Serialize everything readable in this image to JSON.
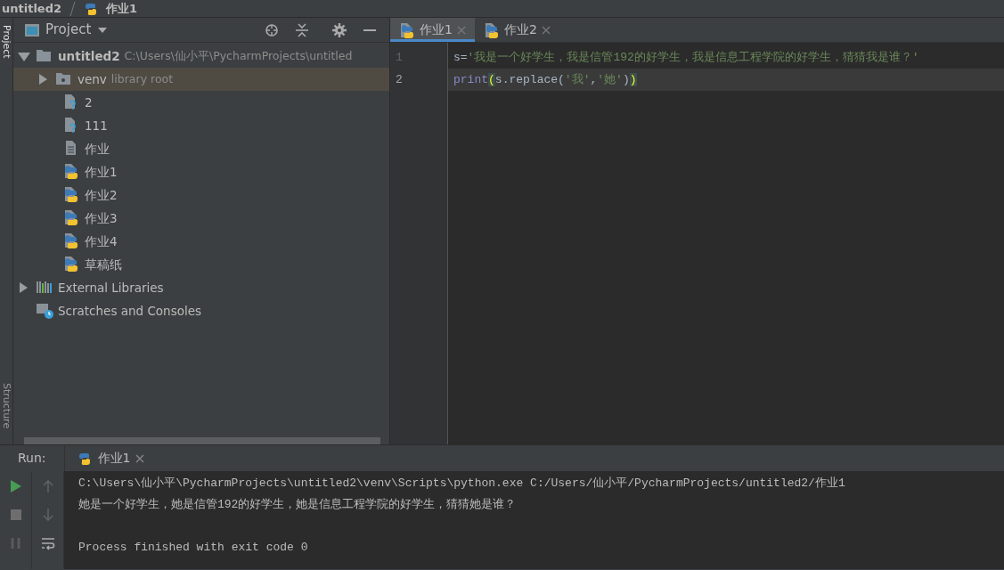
{
  "breadcrumb": [
    "untitled2",
    "作业1"
  ],
  "side_tabs": [
    {
      "label": "Project",
      "selected": true
    },
    {
      "label": "Structure",
      "selected": false
    }
  ],
  "project_panel": {
    "title": "Project",
    "tree": [
      {
        "kind": "folder",
        "label": "untitled2",
        "hint": "C:\\Users\\仙小平\\PycharmProjects\\untitled",
        "expanded": true,
        "selected": false,
        "children": [
          {
            "kind": "venv",
            "label": "venv",
            "hint": "library root",
            "expanded": false,
            "selected": true
          },
          {
            "kind": "unknown",
            "label": "2",
            "selected": false
          },
          {
            "kind": "unknown",
            "label": "111",
            "selected": false
          },
          {
            "kind": "text",
            "label": "作业",
            "selected": false
          },
          {
            "kind": "python",
            "label": "作业1",
            "selected": false
          },
          {
            "kind": "python",
            "label": "作业2",
            "selected": false
          },
          {
            "kind": "python",
            "label": "作业3",
            "selected": false
          },
          {
            "kind": "python",
            "label": "作业4",
            "selected": false
          },
          {
            "kind": "python",
            "label": "草稿纸",
            "selected": false
          }
        ]
      },
      {
        "kind": "libraries",
        "label": "External Libraries",
        "expanded": false,
        "selected": false
      },
      {
        "kind": "scratches",
        "label": "Scratches and Consoles",
        "selected": false
      }
    ]
  },
  "editor": {
    "tabs": [
      {
        "label": "作业1",
        "selected": true
      },
      {
        "label": "作业2",
        "selected": false
      }
    ],
    "lines": [
      {
        "number": "1",
        "current": false,
        "tokens": [
          {
            "kind": "plain",
            "text": "s="
          },
          {
            "kind": "string",
            "text": "'我是一个好学生，我是信管192的好学生，我是信息工程学院的好学生，猜猜我是谁？'"
          }
        ]
      },
      {
        "number": "2",
        "current": true,
        "tokens": [
          {
            "kind": "builtin",
            "text": "print"
          },
          {
            "kind": "brace",
            "text": "("
          },
          {
            "kind": "plain",
            "text": "s.replace("
          },
          {
            "kind": "string",
            "text": "'我'"
          },
          {
            "kind": "plain",
            "text": ","
          },
          {
            "kind": "string",
            "text": "'她'"
          },
          {
            "kind": "plain",
            "text": ")"
          },
          {
            "kind": "brace",
            "text": ")"
          }
        ]
      }
    ]
  },
  "run_panel": {
    "label": "Run:",
    "tab": "作业1",
    "output_blocks": [
      [
        "C:\\Users\\仙小平\\PycharmProjects\\untitled2\\venv\\Scripts\\python.exe C:/Users/仙小平/PycharmProjects/untitled2/作业1",
        "她是一个好学生，她是信管192的好学生，她是信息工程学院的好学生，猜猜她是谁？"
      ],
      [
        "Process finished with exit code 0"
      ]
    ]
  }
}
